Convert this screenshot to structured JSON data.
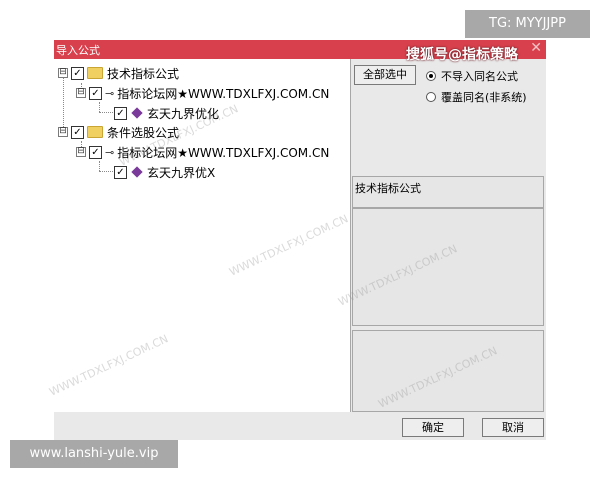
{
  "dialog": {
    "title": "导入公式",
    "close_icon": "✕"
  },
  "overlays": {
    "brand": "搜狐号@指标策略",
    "tg": "TG: MYYJJPP",
    "url": "www.lanshi-yule.vip",
    "watermark": "WWW.TDXLFXJ.COM.CN"
  },
  "tree": {
    "groups": [
      {
        "label": "技术指标公式",
        "checked": true,
        "source": "指标论坛网★WWW.TDXLFXJ.COM.CN",
        "item": "玄天九界优化"
      },
      {
        "label": "条件选股公式",
        "checked": true,
        "source": "指标论坛网★WWW.TDXLFXJ.COM.CN",
        "item": "玄天九界优X"
      }
    ],
    "expander_symbol": "⊟",
    "check_mark": "✓"
  },
  "right": {
    "select_all": "全部选中",
    "radio_no_import": "不导入同名公式",
    "radio_overwrite": "覆盖同名(非系统)",
    "info_title": "技术指标公式"
  },
  "buttons": {
    "ok": "确定",
    "cancel": "取消"
  }
}
